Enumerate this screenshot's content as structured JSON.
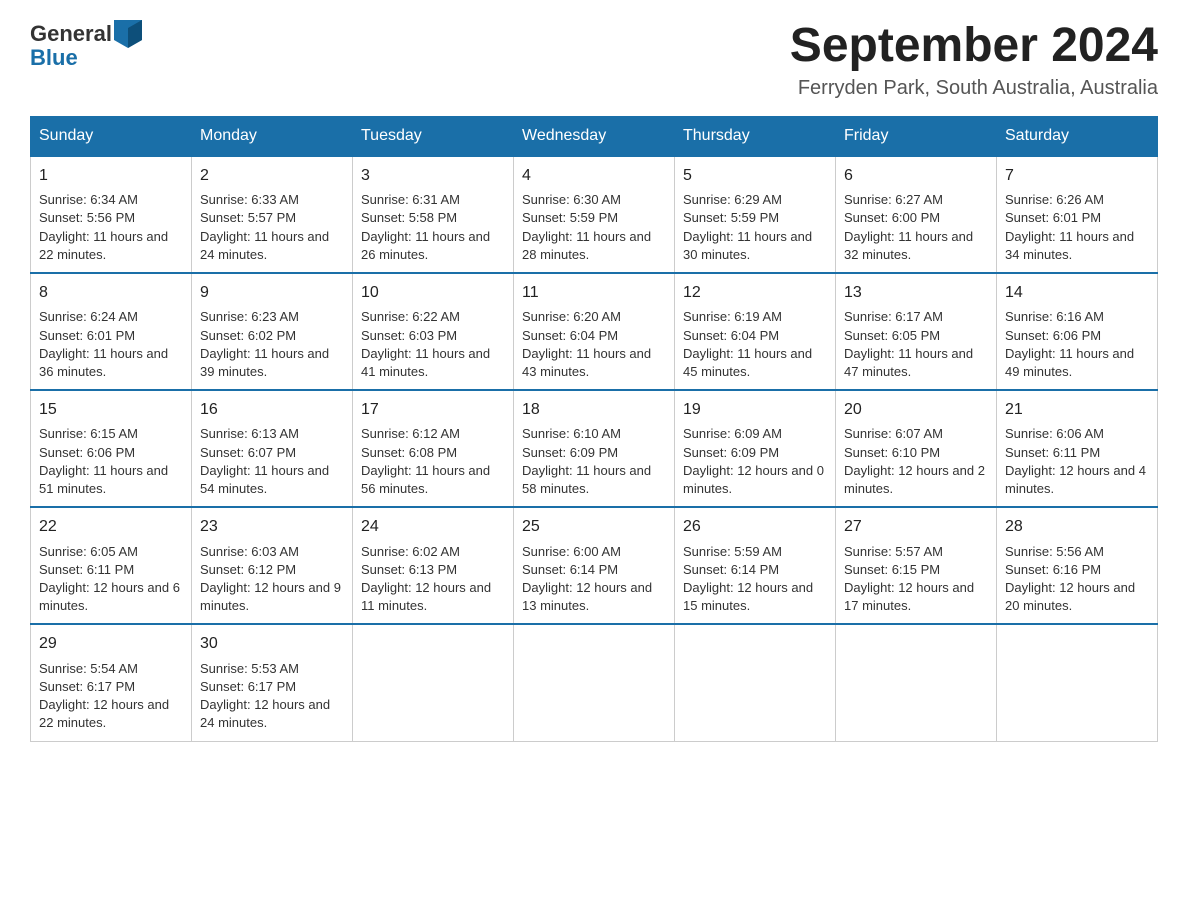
{
  "logo": {
    "general": "General",
    "blue": "Blue"
  },
  "header": {
    "month_year": "September 2024",
    "location": "Ferryden Park, South Australia, Australia"
  },
  "weekdays": [
    "Sunday",
    "Monday",
    "Tuesday",
    "Wednesday",
    "Thursday",
    "Friday",
    "Saturday"
  ],
  "weeks": [
    [
      {
        "day": 1,
        "sunrise": "6:34 AM",
        "sunset": "5:56 PM",
        "daylight": "11 hours and 22 minutes."
      },
      {
        "day": 2,
        "sunrise": "6:33 AM",
        "sunset": "5:57 PM",
        "daylight": "11 hours and 24 minutes."
      },
      {
        "day": 3,
        "sunrise": "6:31 AM",
        "sunset": "5:58 PM",
        "daylight": "11 hours and 26 minutes."
      },
      {
        "day": 4,
        "sunrise": "6:30 AM",
        "sunset": "5:59 PM",
        "daylight": "11 hours and 28 minutes."
      },
      {
        "day": 5,
        "sunrise": "6:29 AM",
        "sunset": "5:59 PM",
        "daylight": "11 hours and 30 minutes."
      },
      {
        "day": 6,
        "sunrise": "6:27 AM",
        "sunset": "6:00 PM",
        "daylight": "11 hours and 32 minutes."
      },
      {
        "day": 7,
        "sunrise": "6:26 AM",
        "sunset": "6:01 PM",
        "daylight": "11 hours and 34 minutes."
      }
    ],
    [
      {
        "day": 8,
        "sunrise": "6:24 AM",
        "sunset": "6:01 PM",
        "daylight": "11 hours and 36 minutes."
      },
      {
        "day": 9,
        "sunrise": "6:23 AM",
        "sunset": "6:02 PM",
        "daylight": "11 hours and 39 minutes."
      },
      {
        "day": 10,
        "sunrise": "6:22 AM",
        "sunset": "6:03 PM",
        "daylight": "11 hours and 41 minutes."
      },
      {
        "day": 11,
        "sunrise": "6:20 AM",
        "sunset": "6:04 PM",
        "daylight": "11 hours and 43 minutes."
      },
      {
        "day": 12,
        "sunrise": "6:19 AM",
        "sunset": "6:04 PM",
        "daylight": "11 hours and 45 minutes."
      },
      {
        "day": 13,
        "sunrise": "6:17 AM",
        "sunset": "6:05 PM",
        "daylight": "11 hours and 47 minutes."
      },
      {
        "day": 14,
        "sunrise": "6:16 AM",
        "sunset": "6:06 PM",
        "daylight": "11 hours and 49 minutes."
      }
    ],
    [
      {
        "day": 15,
        "sunrise": "6:15 AM",
        "sunset": "6:06 PM",
        "daylight": "11 hours and 51 minutes."
      },
      {
        "day": 16,
        "sunrise": "6:13 AM",
        "sunset": "6:07 PM",
        "daylight": "11 hours and 54 minutes."
      },
      {
        "day": 17,
        "sunrise": "6:12 AM",
        "sunset": "6:08 PM",
        "daylight": "11 hours and 56 minutes."
      },
      {
        "day": 18,
        "sunrise": "6:10 AM",
        "sunset": "6:09 PM",
        "daylight": "11 hours and 58 minutes."
      },
      {
        "day": 19,
        "sunrise": "6:09 AM",
        "sunset": "6:09 PM",
        "daylight": "12 hours and 0 minutes."
      },
      {
        "day": 20,
        "sunrise": "6:07 AM",
        "sunset": "6:10 PM",
        "daylight": "12 hours and 2 minutes."
      },
      {
        "day": 21,
        "sunrise": "6:06 AM",
        "sunset": "6:11 PM",
        "daylight": "12 hours and 4 minutes."
      }
    ],
    [
      {
        "day": 22,
        "sunrise": "6:05 AM",
        "sunset": "6:11 PM",
        "daylight": "12 hours and 6 minutes."
      },
      {
        "day": 23,
        "sunrise": "6:03 AM",
        "sunset": "6:12 PM",
        "daylight": "12 hours and 9 minutes."
      },
      {
        "day": 24,
        "sunrise": "6:02 AM",
        "sunset": "6:13 PM",
        "daylight": "12 hours and 11 minutes."
      },
      {
        "day": 25,
        "sunrise": "6:00 AM",
        "sunset": "6:14 PM",
        "daylight": "12 hours and 13 minutes."
      },
      {
        "day": 26,
        "sunrise": "5:59 AM",
        "sunset": "6:14 PM",
        "daylight": "12 hours and 15 minutes."
      },
      {
        "day": 27,
        "sunrise": "5:57 AM",
        "sunset": "6:15 PM",
        "daylight": "12 hours and 17 minutes."
      },
      {
        "day": 28,
        "sunrise": "5:56 AM",
        "sunset": "6:16 PM",
        "daylight": "12 hours and 20 minutes."
      }
    ],
    [
      {
        "day": 29,
        "sunrise": "5:54 AM",
        "sunset": "6:17 PM",
        "daylight": "12 hours and 22 minutes."
      },
      {
        "day": 30,
        "sunrise": "5:53 AM",
        "sunset": "6:17 PM",
        "daylight": "12 hours and 24 minutes."
      },
      null,
      null,
      null,
      null,
      null
    ]
  ]
}
